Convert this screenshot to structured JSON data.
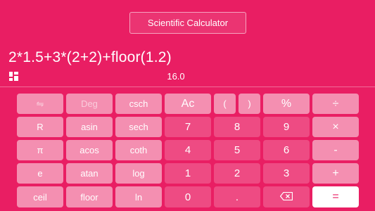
{
  "header": {
    "title": "Scientific Calculator"
  },
  "display": {
    "expression": "2*1.5+3*(2+2)+floor(1.2)",
    "result": "16.0"
  },
  "icons": {
    "menu": "grid-menu-icon",
    "backspace": "backspace-icon",
    "swap": "swap-arrows-icon"
  },
  "keys": {
    "swap": "⇋",
    "deg": "Deg",
    "csch": "csch",
    "ac": "Ac",
    "lparen": "(",
    "rparen": ")",
    "percent": "%",
    "divide": "÷",
    "r": "R",
    "asin": "asin",
    "sech": "sech",
    "seven": "7",
    "eight": "8",
    "nine": "9",
    "multiply": "×",
    "pi": "π",
    "acos": "acos",
    "coth": "coth",
    "four": "4",
    "five": "5",
    "six": "6",
    "minus": "-",
    "e": "e",
    "atan": "atan",
    "log": "log",
    "one": "1",
    "two": "2",
    "three": "3",
    "plus": "+",
    "ceil": "ceil",
    "floor": "floor",
    "ln": "ln",
    "zero": "0",
    "dot": ".",
    "equals": "="
  },
  "colors": {
    "background": "#e91e63",
    "sci_key": "#f48fb1",
    "num_key": "#ee4b83",
    "equals_key": "#ffffff"
  }
}
